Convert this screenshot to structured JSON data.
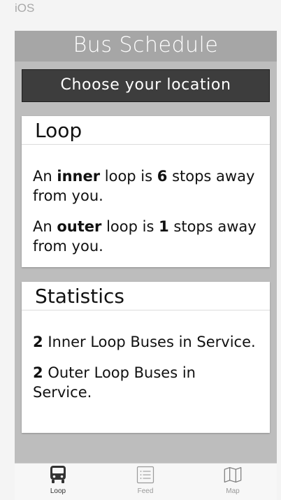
{
  "platform": {
    "label": "iOS"
  },
  "header": {
    "title": "Bus Schedule"
  },
  "location_button": {
    "label": "Choose your location"
  },
  "loop_card": {
    "title": "Loop",
    "inner": {
      "prefix": "An",
      "kind": "inner",
      "mid": "loop is",
      "count": "6",
      "suffix": "stops away from you."
    },
    "outer": {
      "prefix": "An",
      "kind": "outer",
      "mid": "loop is",
      "count": "1",
      "suffix": "stops away from you."
    }
  },
  "stats_card": {
    "title": "Statistics",
    "inner": {
      "count": "2",
      "text": "Inner Loop Buses in Service."
    },
    "outer": {
      "count": "2",
      "text": "Outer Loop Buses in Service."
    }
  },
  "tabbar": {
    "tabs": [
      {
        "label": "Loop",
        "icon": "bus-icon",
        "active": true
      },
      {
        "label": "Feed",
        "icon": "list-icon",
        "active": false
      },
      {
        "label": "Map",
        "icon": "map-icon",
        "active": false
      }
    ]
  }
}
